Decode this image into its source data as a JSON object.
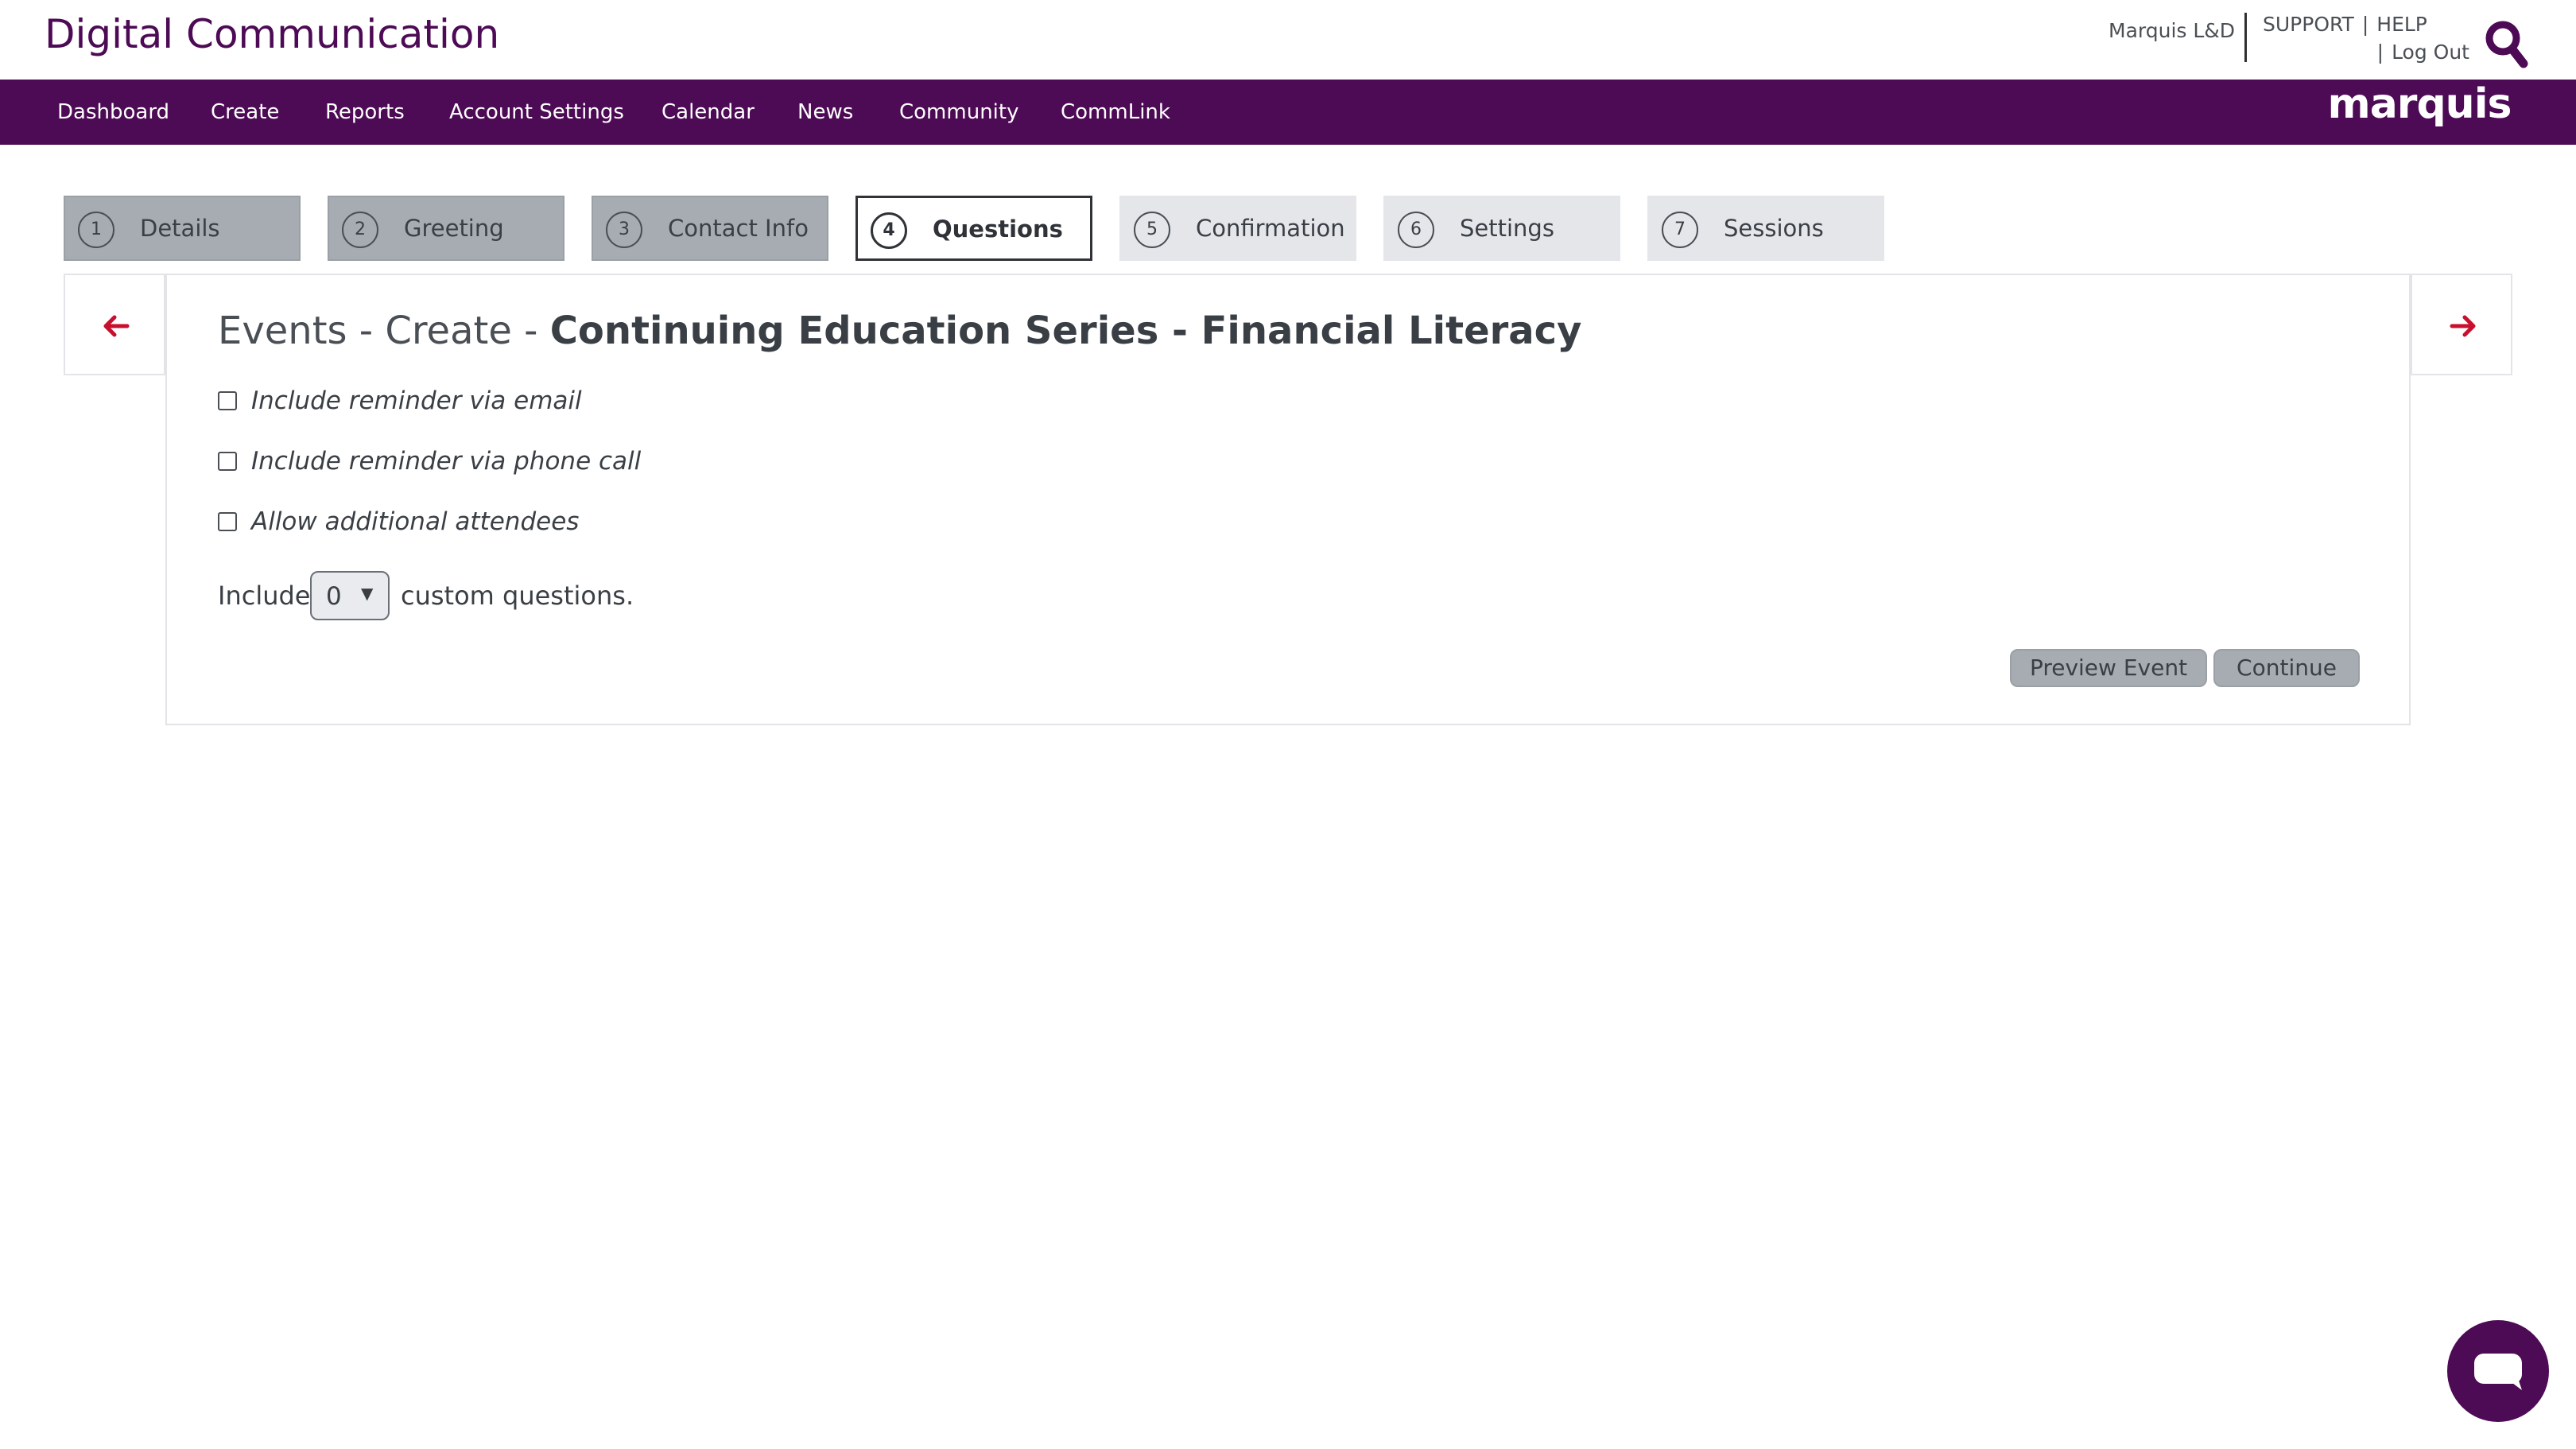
{
  "header": {
    "brand": "Digital Communication",
    "account": "Marquis L&D",
    "support": "SUPPORT",
    "help": "HELP",
    "logout": "Log Out",
    "separator": "|"
  },
  "nav": {
    "items": [
      "Dashboard",
      "Create",
      "Reports",
      "Account Settings",
      "Calendar",
      "News",
      "Community",
      "CommLink"
    ],
    "logo_text": "marquis"
  },
  "steps": [
    {
      "num": "1",
      "label": "Details",
      "state": "completed"
    },
    {
      "num": "2",
      "label": "Greeting",
      "state": "completed"
    },
    {
      "num": "3",
      "label": "Contact Info",
      "state": "completed"
    },
    {
      "num": "4",
      "label": "Questions",
      "state": "active"
    },
    {
      "num": "5",
      "label": "Confirmation",
      "state": "future"
    },
    {
      "num": "6",
      "label": "Settings",
      "state": "future"
    },
    {
      "num": "7",
      "label": "Sessions",
      "state": "future"
    }
  ],
  "main": {
    "title_prefix": "Events - Create - ",
    "title_name": "Continuing Education Series - Financial Literacy",
    "options": [
      {
        "label": "Include reminder via email",
        "checked": false
      },
      {
        "label": "Include reminder via phone call",
        "checked": false
      },
      {
        "label": "Allow additional attendees",
        "checked": false
      }
    ],
    "include_label": "Include",
    "custom_count": "0",
    "custom_suffix": "custom questions.",
    "preview_button": "Preview Event",
    "continue_button": "Continue"
  },
  "colors": {
    "brand_purple": "#4d0a55",
    "arrow_red": "#c8102e",
    "completed_step": "#a7abb2",
    "future_step": "#e4e6ea"
  },
  "icons": {
    "search": "search-icon",
    "prev": "arrow-left-icon",
    "next": "arrow-right-icon",
    "chat": "chat-bubble-icon"
  }
}
